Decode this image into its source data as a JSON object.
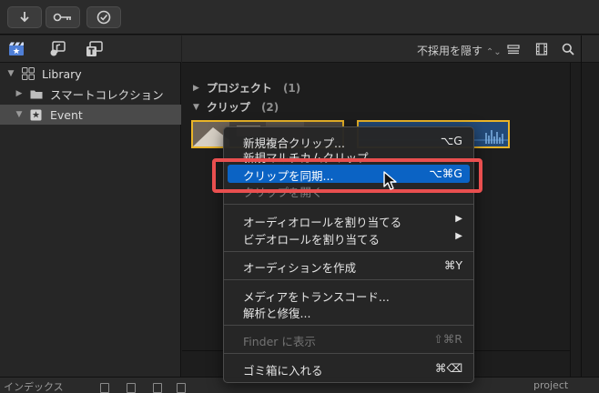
{
  "toolbar": {
    "buttons": [
      {
        "icon": "import-arrow-icon"
      },
      {
        "icon": "key-icon"
      },
      {
        "icon": "checkmark-circle-icon"
      }
    ]
  },
  "sidebar": {
    "tabs": [
      {
        "icon": "libraries-tab-icon"
      },
      {
        "icon": "photos-audio-tab-icon"
      },
      {
        "icon": "titles-generators-tab-icon"
      }
    ],
    "items": [
      {
        "label": "Library"
      },
      {
        "label": "スマートコレクション"
      },
      {
        "label": "Event",
        "selected": true
      }
    ]
  },
  "browser": {
    "filter_label": "不採用を隠す",
    "sections": [
      {
        "label": "プロジェクト",
        "count": "(1)"
      },
      {
        "label": "クリップ",
        "count": "(2)"
      }
    ]
  },
  "status_bar": {
    "left_label": "インデックス",
    "right_label": "project"
  },
  "context_menu": {
    "items": [
      {
        "label": "新規複合クリップ...",
        "shortcut": "⌥G"
      },
      {
        "label": "新規マルチカムクリップ...",
        "shortcut": ""
      },
      {
        "label": "クリップを同期...",
        "shortcut": "⌥⌘G",
        "highlighted": true
      },
      {
        "label": "クリップを開く",
        "shortcut": ""
      },
      {
        "label": "オーディオロールを割り当てる",
        "submenu": "▶"
      },
      {
        "label": "ビデオロールを割り当てる",
        "submenu": "▶"
      },
      {
        "label": "オーディションを作成",
        "shortcut": "⌘Y"
      },
      {
        "label": "メディアをトランスコード...",
        "shortcut": ""
      },
      {
        "label": "解析と修復...",
        "shortcut": ""
      },
      {
        "label": "Finder に表示",
        "shortcut": "⇧⌘R",
        "disabled": true
      },
      {
        "label": "ゴミ箱に入れる",
        "shortcut": "⌘⌫"
      }
    ]
  },
  "colors": {
    "accent": "#0b63c4",
    "highlight_outline": "#e94f4f",
    "clip_border": "#e9b428"
  }
}
